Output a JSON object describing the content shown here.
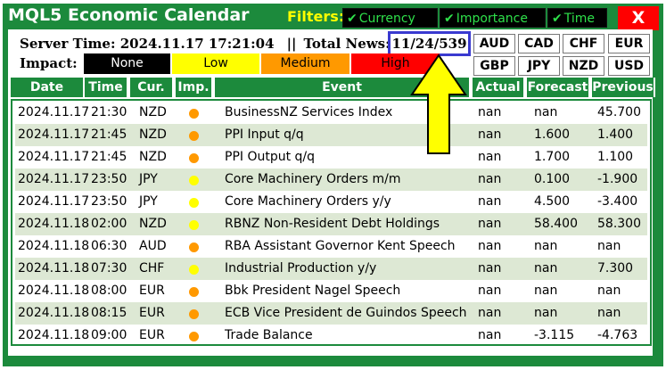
{
  "window": {
    "title": "MQL5 Economic Calendar",
    "close_label": "X"
  },
  "filters": {
    "label": "Filters:",
    "buttons": [
      {
        "label": "Currency",
        "icon": "checkmark-icon"
      },
      {
        "label": "Importance",
        "icon": "checkmark-icon"
      },
      {
        "label": "Time",
        "icon": "checkmark-icon"
      }
    ]
  },
  "info": {
    "server_time": "Server Time: 2024.11.17 17:21:04",
    "separator": "||",
    "total_news_label": "Total News:",
    "total_news_value": "11/24/539"
  },
  "currencies": [
    "AUD",
    "CAD",
    "CHF",
    "EUR",
    "GBP",
    "JPY",
    "NZD",
    "USD"
  ],
  "impact": {
    "label": "Impact:",
    "levels": [
      {
        "label": "None",
        "color": "#000000"
      },
      {
        "label": "Low",
        "color": "#ffff00"
      },
      {
        "label": "Medium",
        "color": "#ff9900"
      },
      {
        "label": "High",
        "color": "#ff0000"
      }
    ]
  },
  "table": {
    "columns": [
      "Date",
      "Time",
      "Cur.",
      "Imp.",
      "Event",
      "Actual",
      "Forecast",
      "Previous"
    ],
    "rows": [
      {
        "date": "2024.11.17",
        "time": "21:30",
        "cur": "NZD",
        "imp_color": "#ff9900",
        "event": "BusinessNZ Services Index",
        "actual": "nan",
        "forecast": "nan",
        "previous": "45.700"
      },
      {
        "date": "2024.11.17",
        "time": "21:45",
        "cur": "NZD",
        "imp_color": "#ff9900",
        "event": "PPI Input q/q",
        "actual": "nan",
        "forecast": "1.600",
        "previous": "1.400"
      },
      {
        "date": "2024.11.17",
        "time": "21:45",
        "cur": "NZD",
        "imp_color": "#ff9900",
        "event": "PPI Output q/q",
        "actual": "nan",
        "forecast": "1.700",
        "previous": "1.100"
      },
      {
        "date": "2024.11.17",
        "time": "23:50",
        "cur": "JPY",
        "imp_color": "#ffff00",
        "event": "Core Machinery Orders m/m",
        "actual": "nan",
        "forecast": "0.100",
        "previous": "-1.900"
      },
      {
        "date": "2024.11.17",
        "time": "23:50",
        "cur": "JPY",
        "imp_color": "#ffff00",
        "event": "Core Machinery Orders y/y",
        "actual": "nan",
        "forecast": "4.500",
        "previous": "-3.400"
      },
      {
        "date": "2024.11.18",
        "time": "02:00",
        "cur": "NZD",
        "imp_color": "#ffff00",
        "event": "RBNZ Non-Resident Debt Holdings",
        "actual": "nan",
        "forecast": "58.400",
        "previous": "58.300"
      },
      {
        "date": "2024.11.18",
        "time": "06:30",
        "cur": "AUD",
        "imp_color": "#ff9900",
        "event": "RBA Assistant Governor Kent Speech",
        "actual": "nan",
        "forecast": "nan",
        "previous": "nan"
      },
      {
        "date": "2024.11.18",
        "time": "07:30",
        "cur": "CHF",
        "imp_color": "#ffff00",
        "event": "Industrial Production y/y",
        "actual": "nan",
        "forecast": "nan",
        "previous": "7.300"
      },
      {
        "date": "2024.11.18",
        "time": "08:00",
        "cur": "EUR",
        "imp_color": "#ff9900",
        "event": "Bbk President Nagel Speech",
        "actual": "nan",
        "forecast": "nan",
        "previous": "nan"
      },
      {
        "date": "2024.11.18",
        "time": "08:15",
        "cur": "EUR",
        "imp_color": "#ff9900",
        "event": "ECB Vice President de Guindos Speech",
        "actual": "nan",
        "forecast": "nan",
        "previous": "nan"
      },
      {
        "date": "2024.11.18",
        "time": "09:00",
        "cur": "EUR",
        "imp_color": "#ff9900",
        "event": "Trade Balance",
        "actual": "nan",
        "forecast": "-3.115",
        "previous": "-4.763"
      }
    ]
  },
  "theme": {
    "accent": "#1c8a3c",
    "alt_row": "#dde8d4",
    "highlight": "#3a3ad0",
    "arrow": "#ffff00"
  }
}
